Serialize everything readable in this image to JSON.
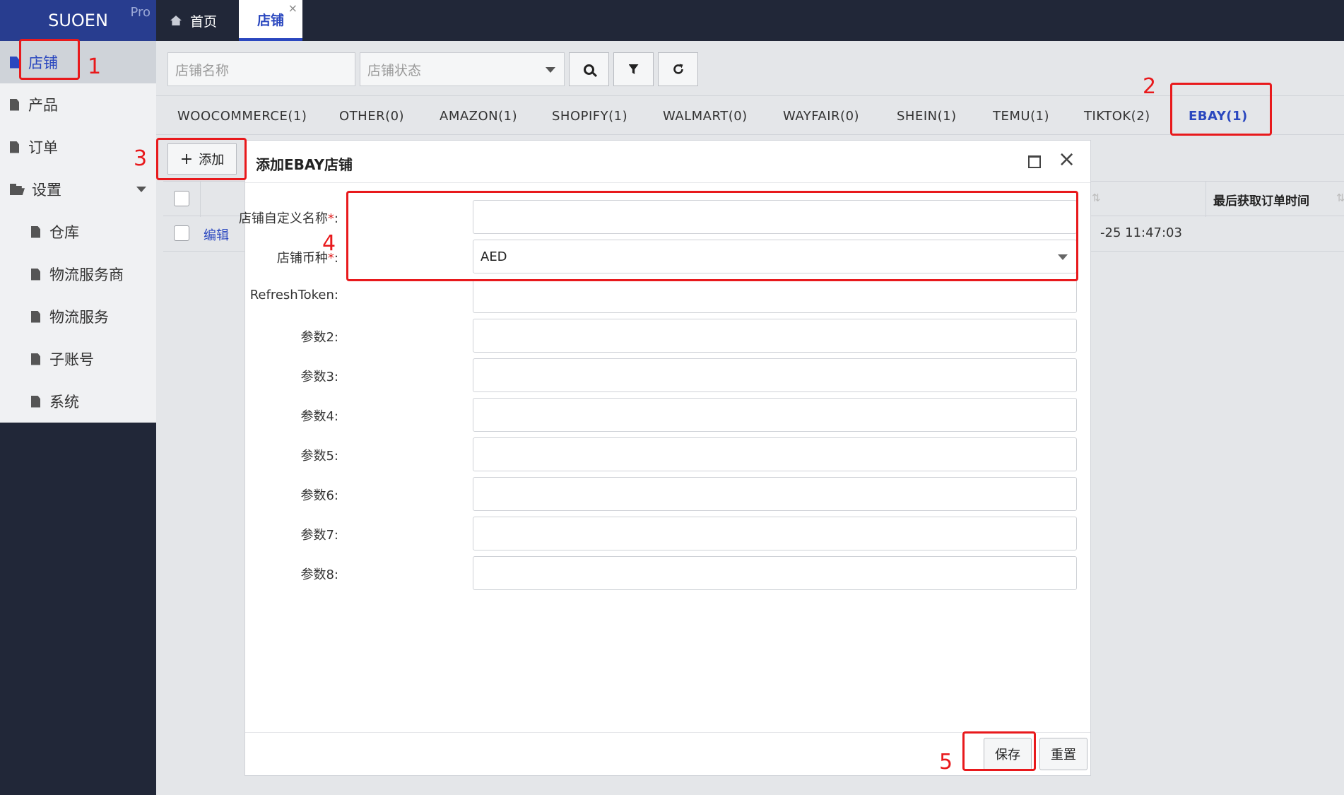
{
  "app": {
    "logo": "SUOEN",
    "logo_badge": "Pro"
  },
  "tabs": {
    "home": "首页",
    "shop": "店铺",
    "close": "×"
  },
  "sidebar": {
    "items": [
      {
        "label": "店铺"
      },
      {
        "label": "产品"
      },
      {
        "label": "订单"
      },
      {
        "label": "设置"
      }
    ],
    "sub_items": [
      {
        "label": "仓库"
      },
      {
        "label": "物流服务商"
      },
      {
        "label": "物流服务"
      },
      {
        "label": "子账号"
      },
      {
        "label": "系统"
      }
    ]
  },
  "search": {
    "name_placeholder": "店铺名称",
    "status_placeholder": "店铺状态"
  },
  "platforms": [
    "WOOCOMMERCE(1)",
    "OTHER(0)",
    "AMAZON(1)",
    "SHOPIFY(1)",
    "WALMART(0)",
    "WAYFAIR(0)",
    "SHEIN(1)",
    "TEMU(1)",
    "TIKTOK(2)",
    "EBAY(1)"
  ],
  "toolbar": {
    "add_label": "添加",
    "add_symbol": "+"
  },
  "table": {
    "last_fetch_header": "最后获取订单时间",
    "sort_symbol": "⇅",
    "row": {
      "edit": "编辑",
      "time": "-25 11:47:03"
    }
  },
  "dialog": {
    "title": "添加EBAY店铺",
    "close": "×",
    "fields": [
      {
        "label": "店铺自定义名称",
        "required": "*",
        "value": ""
      },
      {
        "label": "店铺币种",
        "required": "*",
        "value": "AED"
      },
      {
        "label": "RefreshToken",
        "value": ""
      },
      {
        "label": "参数2",
        "value": ""
      },
      {
        "label": "参数3",
        "value": ""
      },
      {
        "label": "参数4",
        "value": ""
      },
      {
        "label": "参数5",
        "value": ""
      },
      {
        "label": "参数6",
        "value": ""
      },
      {
        "label": "参数7",
        "value": ""
      },
      {
        "label": "参数8",
        "value": ""
      }
    ],
    "colon": ":",
    "save": "保存",
    "reset": "重置"
  },
  "annotations": [
    "1",
    "2",
    "3",
    "4",
    "5"
  ],
  "colors": {
    "accent": "#2a47bf",
    "annotation": "#e8191c",
    "sidebar_dark": "#212738"
  }
}
